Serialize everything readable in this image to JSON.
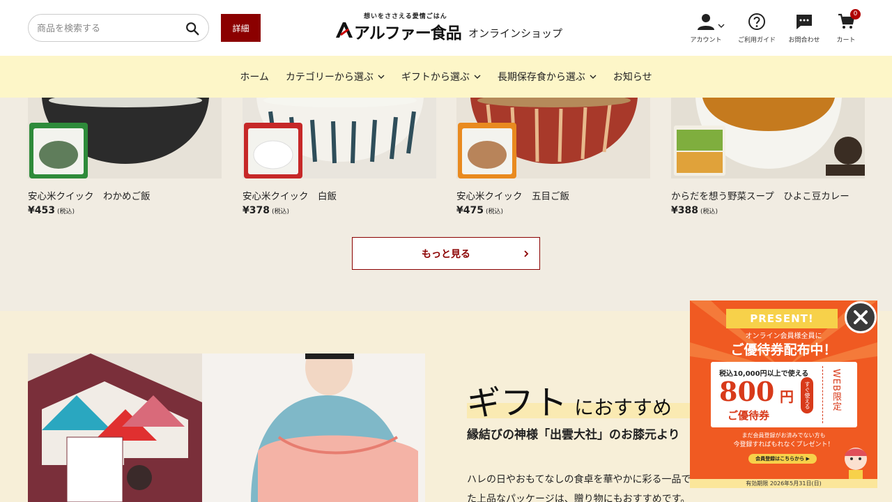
{
  "header": {
    "search_placeholder": "商品を検索する",
    "detail_label": "詳細",
    "tagline": "想いをささえる愛情ごはん",
    "brand": "アルファー食品",
    "shop": "オンラインショップ",
    "account_label": "アカウント",
    "guide_label": "ご利用ガイド",
    "contact_label": "お問合わせ",
    "cart_label": "カート",
    "cart_count": "0"
  },
  "nav": {
    "items": [
      {
        "label": "ホーム"
      },
      {
        "label": "カテゴリーから選ぶ"
      },
      {
        "label": "ギフトから選ぶ"
      },
      {
        "label": "長期保存食から選ぶ"
      },
      {
        "label": "お知らせ"
      }
    ]
  },
  "products": [
    {
      "name": "安心米クイック　わかめご飯",
      "price": "¥453",
      "tax": "(税込)"
    },
    {
      "name": "安心米クイック　白飯",
      "price": "¥378",
      "tax": "(税込)"
    },
    {
      "name": "安心米クイック　五目ご飯",
      "price": "¥475",
      "tax": "(税込)"
    },
    {
      "name": "からだを想う野菜スープ　ひよこ豆カレー",
      "price": "¥388",
      "tax": "(税込)"
    }
  ],
  "more_label": "もっと見る",
  "gift": {
    "heading_big": "ギフト",
    "heading_small": "におすすめ",
    "subheading": "縁結びの神様「出雲大社」のお膝元より",
    "desc_line1": "ハレの日やおもてなしの食卓を華やかに彩る一品で",
    "desc_line2": "た上品なパッケージは、贈り物にもおすすめです。"
  },
  "popup": {
    "ribbon": "PRESENT!",
    "line1": "オンライン会員様全員に",
    "line2": "ご優待券配布中！",
    "ticket_condition": "税込10,000円以上で使える",
    "amount": "800",
    "yen": "円",
    "stamp": "すぐ使える",
    "ticket_name": "ご優待券",
    "web_only": "WEB限定",
    "note1": "まだ会員登録がお済みでない方も",
    "note2": "今登録すればもれなくプレゼント！",
    "cta": "会員登録はこちらから ▶",
    "expiry": "有効期限 2026年5月31日(日)"
  }
}
